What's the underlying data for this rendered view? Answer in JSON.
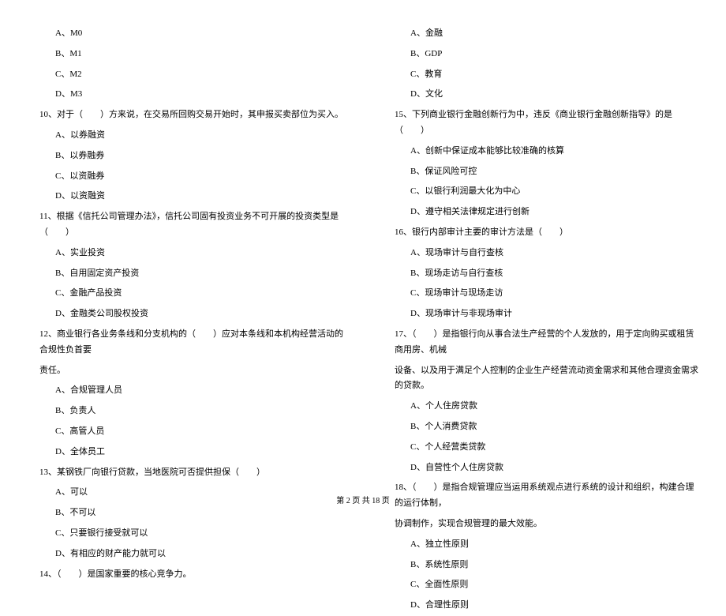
{
  "left_column": {
    "q9_options": [
      "A、M0",
      "B、M1",
      "C、M2",
      "D、M3"
    ],
    "q10": {
      "text_before": "10、对于（　　）方来说，在交易所回购交易开始时，其申报买卖部位为买入。",
      "options": [
        "A、以券融资",
        "B、以券融券",
        "C、以资融券",
        "D、以资融资"
      ]
    },
    "q11": {
      "text": "11、根据《信托公司管理办法》，信托公司固有投资业务不可开展的投资类型是（　　）",
      "options": [
        "A、实业投资",
        "B、自用固定资产投资",
        "C、金融产品投资",
        "D、金融类公司股权投资"
      ]
    },
    "q12": {
      "text": "12、商业银行各业务条线和分支机构的（　　）应对本条线和本机构经营活动的合规性负首要",
      "text_cont": "责任。",
      "options": [
        "A、合规管理人员",
        "B、负责人",
        "C、高管人员",
        "D、全体员工"
      ]
    },
    "q13": {
      "text": "13、某钢铁厂向银行贷款，当地医院可否提供担保（　　）",
      "options": [
        "A、可以",
        "B、不可以",
        "C、只要银行接受就可以",
        "D、有相应的财产能力就可以"
      ]
    },
    "q14": {
      "text": "14、（　　）是国家重要的核心竞争力。"
    }
  },
  "right_column": {
    "q14_options": [
      "A、金融",
      "B、GDP",
      "C、教育",
      "D、文化"
    ],
    "q15": {
      "text": "15、下列商业银行金融创新行为中，违反《商业银行金融创新指导》的是（　　）",
      "options": [
        "A、创新中保证成本能够比较准确的核算",
        "B、保证风险可控",
        "C、以银行利润最大化为中心",
        "D、遵守相关法律规定进行创新"
      ]
    },
    "q16": {
      "text": "16、银行内部审计主要的审计方法是（　　）",
      "options": [
        "A、现场审计与自行查核",
        "B、现场走访与自行查核",
        "C、现场审计与现场走访",
        "D、现场审计与非现场审计"
      ]
    },
    "q17": {
      "text": "17、（　　）是指银行向从事合法生产经营的个人发放的，用于定向购买或租赁商用房、机械",
      "text_cont": "设备、以及用于满足个人控制的企业生产经营流动资金需求和其他合理资金需求的贷款。",
      "options": [
        "A、个人住房贷款",
        "B、个人消费贷款",
        "C、个人经营类贷款",
        "D、自营性个人住房贷款"
      ]
    },
    "q18": {
      "text": "18、（　　）是指合规管理应当运用系统观点进行系统的设计和组织，构建合理的运行体制，",
      "text_cont": "协调制作，实现合规管理的最大效能。",
      "options": [
        "A、独立性原则",
        "B、系统性原则",
        "C、全面性原则",
        "D、合理性原则"
      ]
    }
  },
  "footer": "第 2 页 共 18 页"
}
